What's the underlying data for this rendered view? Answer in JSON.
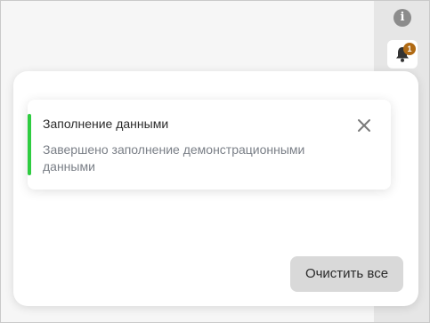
{
  "sidebar": {
    "info_icon": "info-icon",
    "info_glyph": "i",
    "bell_icon": "bell-icon",
    "notification_count": "1"
  },
  "notification": {
    "title": "Заполнение данными",
    "message": "Завершено заполнение демонстрационными данными",
    "close_icon": "close-icon",
    "accent_color": "#2ecc40"
  },
  "panel": {
    "clear_all_label": "Очистить все"
  },
  "colors": {
    "badge": "#b06a14",
    "background": "#f6f6f6",
    "button": "#d9d9d9"
  }
}
